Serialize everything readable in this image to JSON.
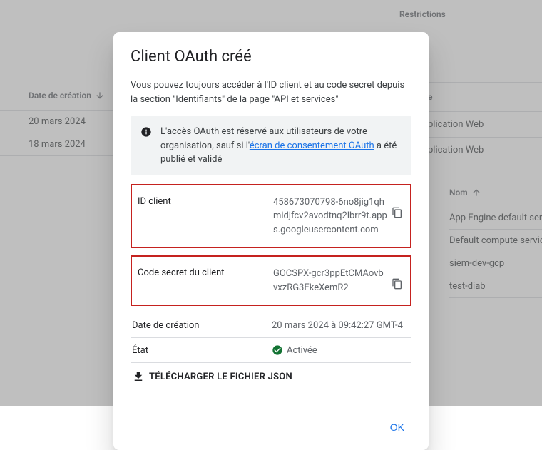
{
  "bg": {
    "restrictions_header": "Restrictions",
    "type_header_partial": "e",
    "type_rows": [
      "plication Web",
      "plication Web"
    ],
    "create_date_header": "Date de création",
    "create_rows": [
      "20 mars 2024",
      "18 mars 2024"
    ],
    "name_header": "Nom",
    "name_rows": [
      "App Engine default servic",
      "Default compute service",
      "siem-dev-gcp",
      "test-diab"
    ]
  },
  "modal": {
    "title": "Client OAuth créé",
    "desc": "Vous pouvez toujours accéder à l'ID client et au code secret depuis la section \"Identifiants\" de la page \"API et services\"",
    "info_pre": "L'accès OAuth est réservé aux utilisateurs de votre organisation, sauf si l'",
    "info_link": "écran de consentement OAuth",
    "info_post": " a été publié et validé",
    "client_id_label": "ID client",
    "client_id_value": "458673070798-6no8jig1qhmidjfcv2avodtnq2lbrr9t.apps.googleusercontent.com",
    "secret_label": "Code secret du client",
    "secret_value": "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",
    "created_label": "Date de création",
    "created_value": "20 mars 2024 à 09:42:27 GMT-4",
    "status_label": "État",
    "status_value": "Activée",
    "download_label": "TÉLÉCHARGER LE FICHIER JSON",
    "ok": "OK"
  }
}
